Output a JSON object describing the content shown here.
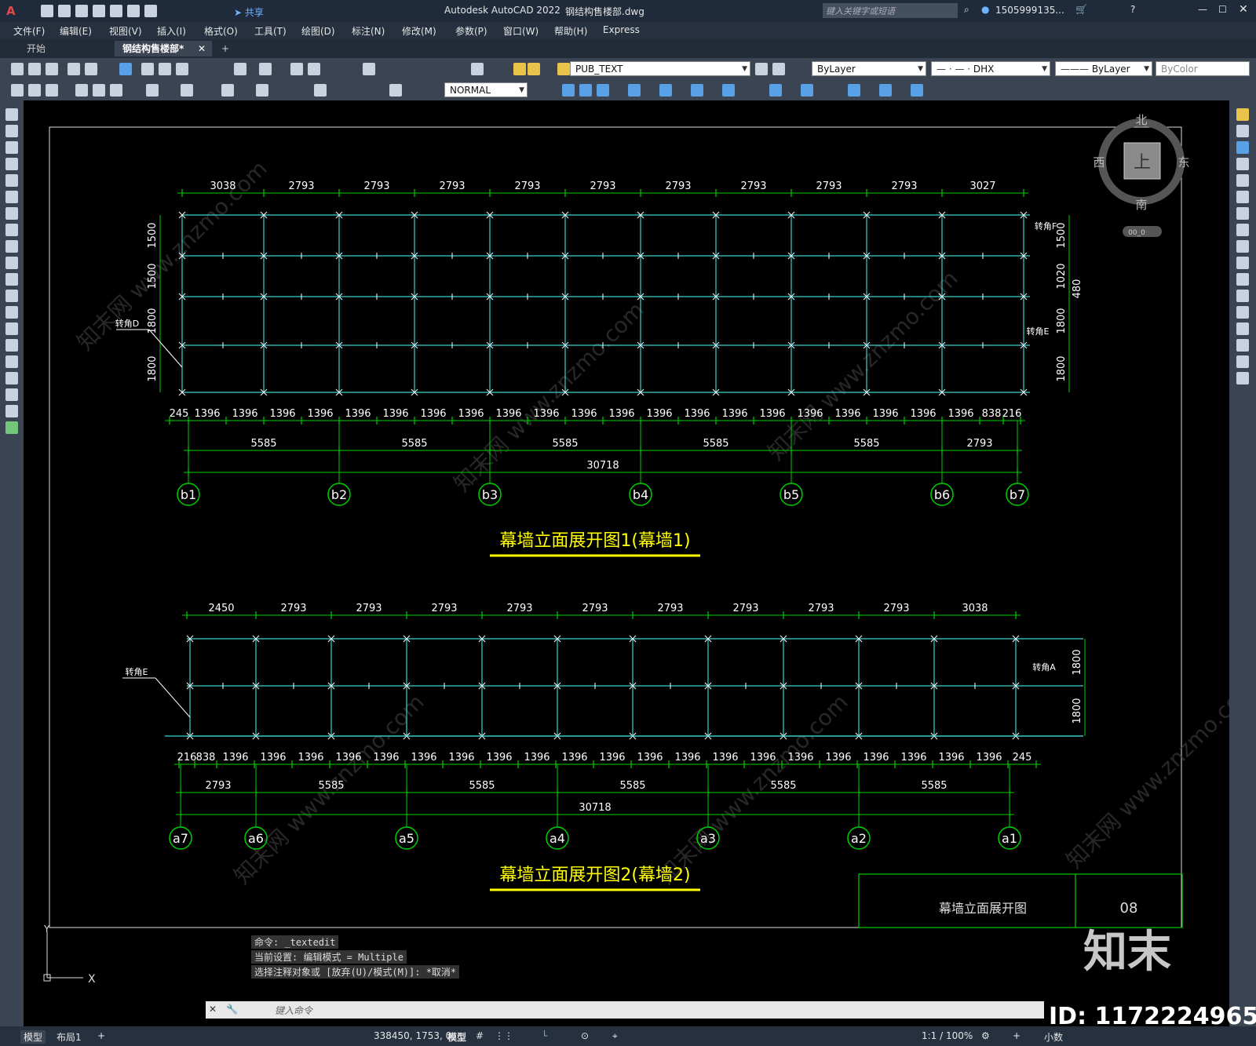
{
  "window": {
    "app_title": "Autodesk AutoCAD 2022",
    "file_name": "钢结构售楼部.dwg",
    "search_placeholder": "键入关键字或短语",
    "user": "1505999135...",
    "share_label": "共享"
  },
  "menu": [
    "文件(F)",
    "编辑(E)",
    "视图(V)",
    "插入(I)",
    "格式(O)",
    "工具(T)",
    "绘图(D)",
    "标注(N)",
    "修改(M)",
    "参数(P)",
    "窗口(W)",
    "帮助(H)",
    "Express"
  ],
  "tabs": [
    {
      "label": "开始",
      "active": false
    },
    {
      "label": "钢结构售楼部*",
      "active": true
    }
  ],
  "toolbar": {
    "text_style": "PUB_TEXT",
    "layer_color": "ByLayer",
    "linetype": "DHX",
    "lineweight": "ByLayer",
    "plot_color": "ByColor",
    "dim_style": "NORMAL"
  },
  "viewcube": {
    "north": "北",
    "south": "南",
    "east": "东",
    "west": "西",
    "face": "上",
    "wcs": "00_0"
  },
  "drawing1": {
    "top_dims": [
      "3038",
      "2793",
      "2793",
      "2793",
      "2793",
      "2793",
      "2793",
      "2793",
      "2793",
      "2793",
      "3027"
    ],
    "bottom_dims": [
      "245",
      "1396",
      "1396",
      "1396",
      "1396",
      "1396",
      "1396",
      "1396",
      "1396",
      "1396",
      "1396",
      "1396",
      "1396",
      "1396",
      "1396",
      "1396",
      "1396",
      "1396",
      "1396",
      "1396",
      "1396",
      "1396",
      "838",
      "216"
    ],
    "mid_dims": [
      "5585",
      "5585",
      "5585",
      "5585",
      "5585",
      "2793"
    ],
    "total": "30718",
    "left_dims": [
      "1500",
      "1500",
      "1800",
      "1800"
    ],
    "right_dims": [
      "1500",
      "1020",
      "1800",
      "1800"
    ],
    "right_extra": "480",
    "axes": [
      "b1",
      "b2",
      "b3",
      "b4",
      "b5",
      "b6",
      "b7"
    ],
    "corner_left": "转角D",
    "corner_right_top": "转角F",
    "corner_right_bottom": "转角E",
    "title": "幕墙立面展开图1(幕墙1)"
  },
  "drawing2": {
    "top_dims": [
      "2450",
      "2793",
      "2793",
      "2793",
      "2793",
      "2793",
      "2793",
      "2793",
      "2793",
      "2793",
      "3038"
    ],
    "bottom_dims": [
      "216",
      "838",
      "1396",
      "1396",
      "1396",
      "1396",
      "1396",
      "1396",
      "1396",
      "1396",
      "1396",
      "1396",
      "1396",
      "1396",
      "1396",
      "1396",
      "1396",
      "1396",
      "1396",
      "1396",
      "1396",
      "1396",
      "1396",
      "245"
    ],
    "mid_dims": [
      "2793",
      "5585",
      "5585",
      "5585",
      "5585",
      "5585"
    ],
    "total": "30718",
    "right_dims": [
      "1800",
      "1800"
    ],
    "axes": [
      "a7",
      "a6",
      "a5",
      "a4",
      "a3",
      "a2",
      "a1"
    ],
    "corner_left": "转角E",
    "corner_right": "转角A",
    "title": "幕墙立面展开图2(幕墙2)"
  },
  "titleblock": {
    "name": "幕墙立面展开图",
    "number": "08"
  },
  "command": {
    "history": [
      "命令: _textedit",
      "当前设置: 编辑模式 = Multiple",
      "选择注释对象或 [放弃(U)/模式(M)]: *取消*"
    ],
    "prompt": "键入命令"
  },
  "status": {
    "layout_tabs": [
      "模型",
      "布局1"
    ],
    "coords": "338450, 1753, 0",
    "space": "模型",
    "scale": "1:1 / 100%",
    "units": "小数"
  },
  "watermark": {
    "brand": "知末",
    "id": "ID: 1172224965"
  }
}
